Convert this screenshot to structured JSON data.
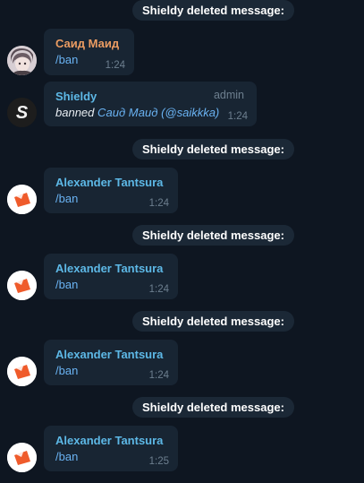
{
  "service_messages": [
    "Shieldy deleted message:",
    "Shieldy deleted message:",
    "Shieldy deleted message:",
    "Shieldy deleted message:",
    "Shieldy deleted message:"
  ],
  "messages": [
    {
      "author": "Саид Маид",
      "text": "/ban",
      "time": "1:24",
      "avatar": "anime-user-avatar"
    },
    {
      "author": "Shieldy",
      "badge": "admin",
      "text_prefix": "banned",
      "user_name": "Саид Маид",
      "user_handle": "(@saikkka)",
      "time": "1:24",
      "avatar": "shieldy-s-avatar"
    },
    {
      "author": "Alexander Tantsura",
      "text": "/ban",
      "time": "1:24",
      "avatar": "orange-logo-avatar"
    },
    {
      "author": "Alexander Tantsura",
      "text": "/ban",
      "time": "1:24",
      "avatar": "orange-logo-avatar"
    },
    {
      "author": "Alexander Tantsura",
      "text": "/ban",
      "time": "1:24",
      "avatar": "orange-logo-avatar"
    },
    {
      "author": "Alexander Tantsura",
      "text": "/ban",
      "time": "1:25",
      "avatar": "orange-logo-avatar"
    }
  ],
  "colors": {
    "background": "#0e1621",
    "bubble": "#182533",
    "service_pill": "#1b2836",
    "name_orange": "#eb9c62",
    "name_blue": "#5db8e6",
    "link": "#6ab3f3",
    "meta": "#6d7f8f"
  }
}
